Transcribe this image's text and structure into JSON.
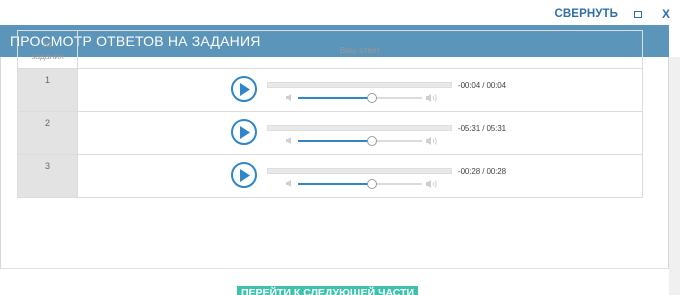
{
  "window": {
    "collapse_label": "СВЕРНУТЬ",
    "close_label": "X"
  },
  "header": {
    "title": "ПРОСМОТР ОТВЕТОВ НА ЗАДАНИЯ"
  },
  "table": {
    "col_num_line1": "№",
    "col_num_line2": "задания",
    "col_answer": "Ваш ответ",
    "rows": [
      {
        "num": "1",
        "time": "-00:04 / 00:04",
        "volume": 0.6
      },
      {
        "num": "2",
        "time": "-05:31 / 05:31",
        "volume": 0.6
      },
      {
        "num": "3",
        "time": "-00:28 / 00:28",
        "volume": 0.6
      }
    ]
  },
  "footer": {
    "next_label": "ПЕРЕЙТИ К СЛЕДУЮЩЕЙ ЧАСТИ"
  },
  "colors": {
    "header": "#5b95ba",
    "accent": "#2f86c8",
    "button": "#3fc2ab"
  }
}
